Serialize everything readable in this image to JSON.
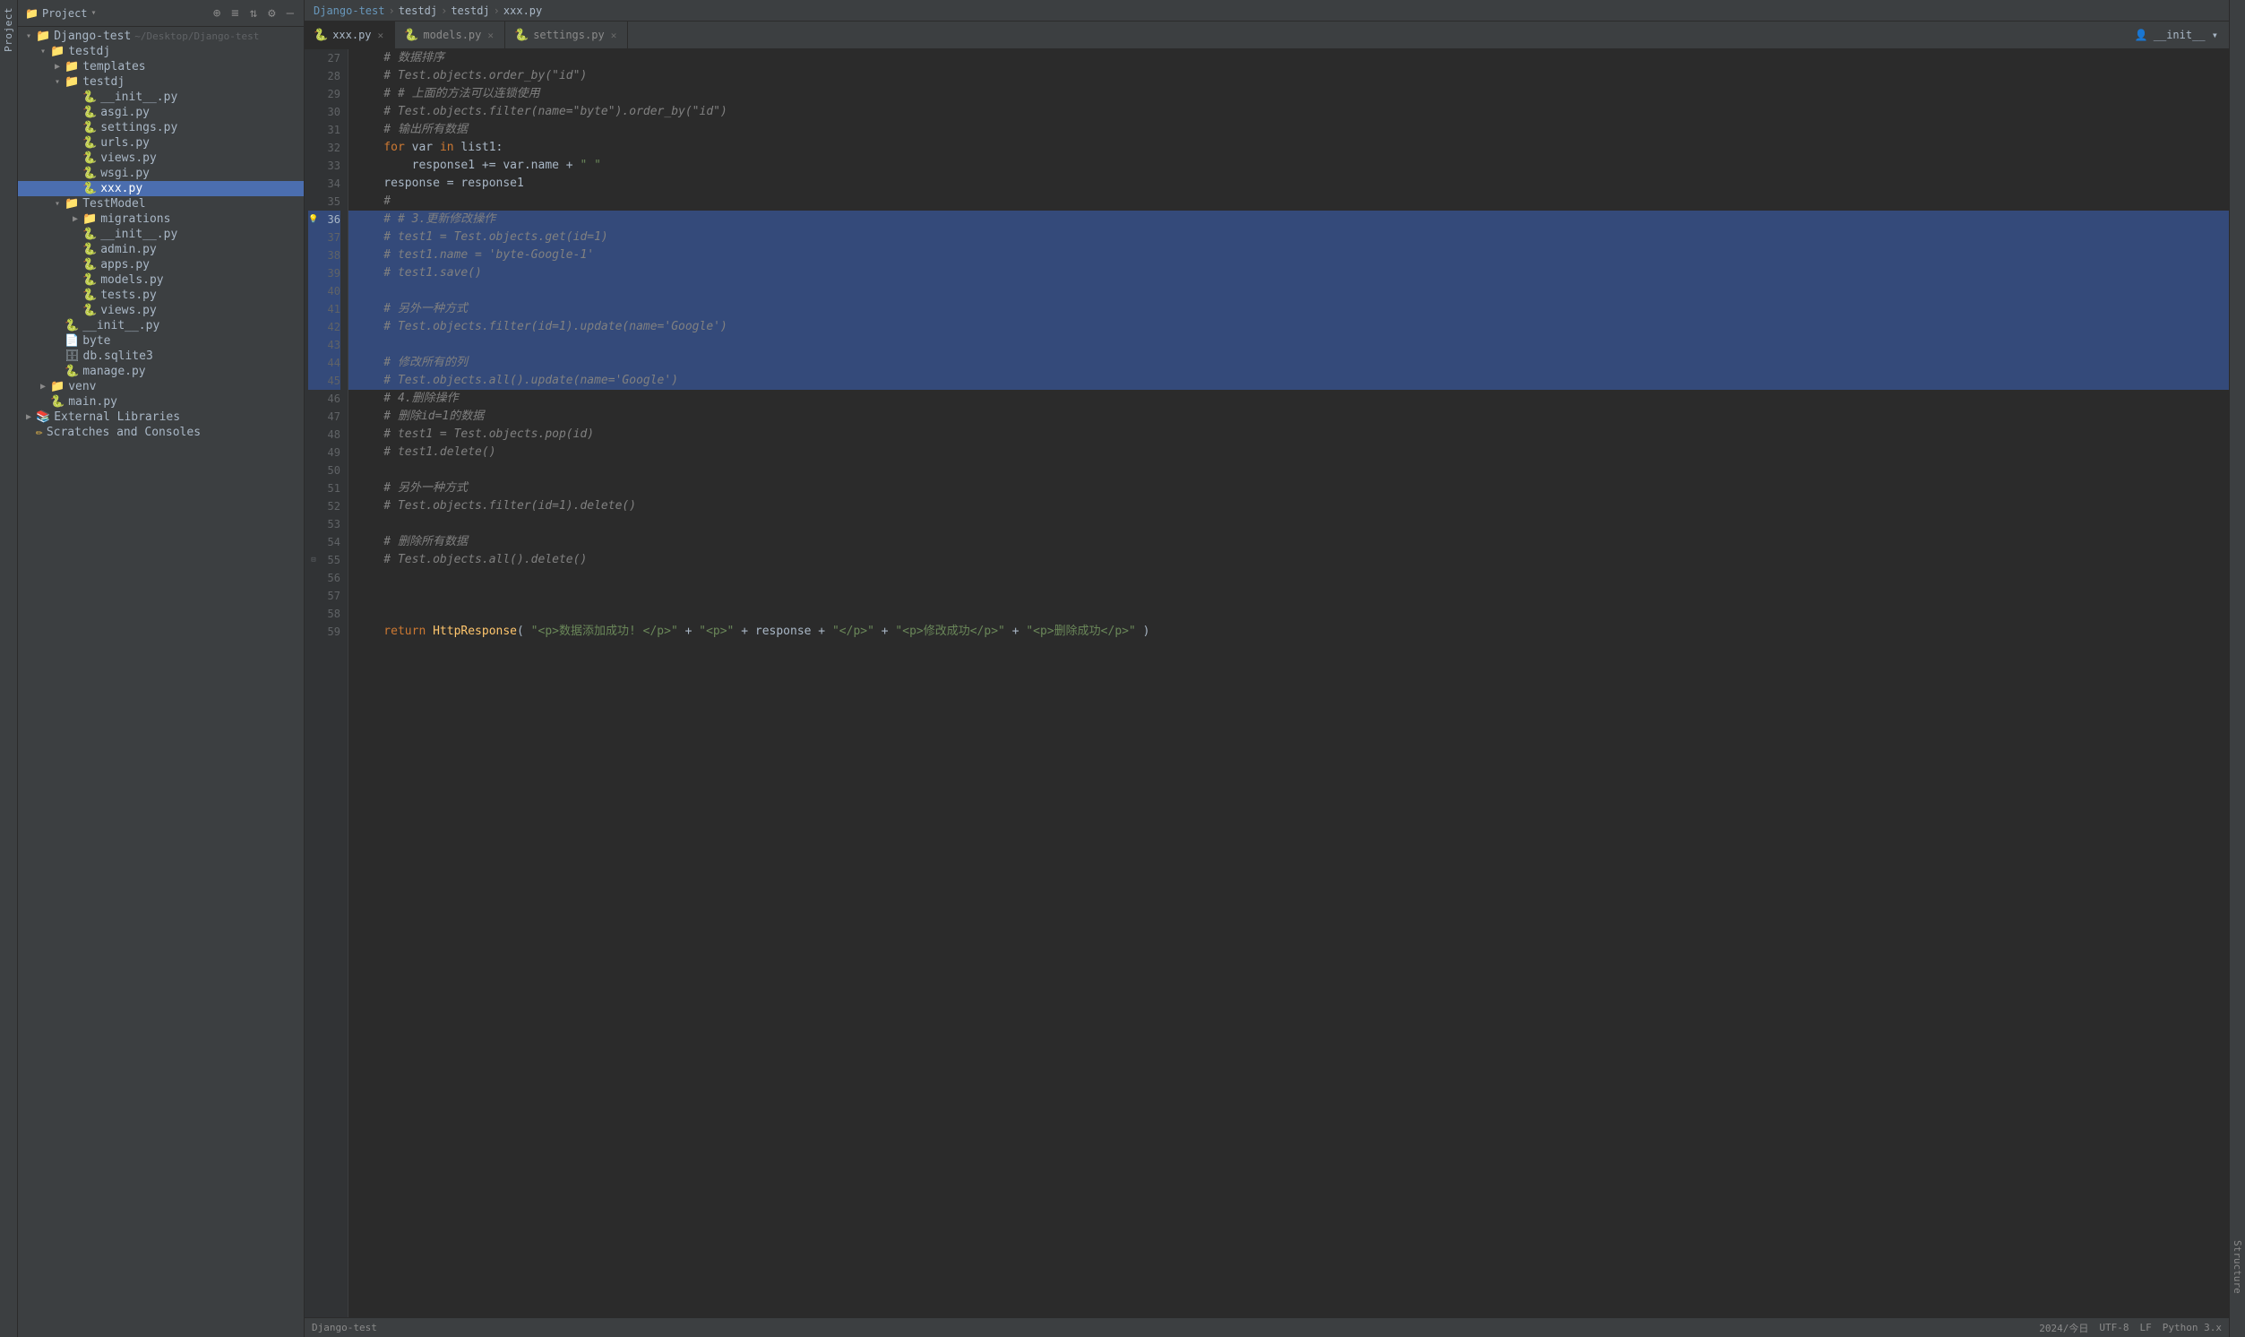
{
  "window": {
    "title": "Django-test"
  },
  "breadcrumb": {
    "items": [
      "Django-test",
      "testdj",
      "testdj",
      "xxx.py"
    ]
  },
  "tabs": [
    {
      "label": "xxx.py",
      "active": true,
      "icon": "py"
    },
    {
      "label": "models.py",
      "active": false,
      "icon": "py"
    },
    {
      "label": "settings.py",
      "active": false,
      "icon": "py"
    }
  ],
  "project_panel": {
    "title": "Project",
    "root": {
      "name": "Django-test",
      "path": "~/Desktop/Django-test",
      "children": [
        {
          "name": "testdj",
          "type": "folder",
          "expanded": true,
          "children": [
            {
              "name": "templates",
              "type": "folder",
              "expanded": false
            },
            {
              "name": "testdj",
              "type": "folder",
              "expanded": true,
              "children": [
                {
                  "name": "__init__.py",
                  "type": "py"
                },
                {
                  "name": "asgi.py",
                  "type": "py"
                },
                {
                  "name": "settings.py",
                  "type": "py"
                },
                {
                  "name": "urls.py",
                  "type": "py"
                },
                {
                  "name": "views.py",
                  "type": "py"
                },
                {
                  "name": "wsgi.py",
                  "type": "py"
                },
                {
                  "name": "xxx.py",
                  "type": "py",
                  "selected": true
                }
              ]
            },
            {
              "name": "TestModel",
              "type": "folder",
              "expanded": true,
              "children": [
                {
                  "name": "migrations",
                  "type": "folder",
                  "expanded": false
                },
                {
                  "name": "__init__.py",
                  "type": "py"
                },
                {
                  "name": "admin.py",
                  "type": "py"
                },
                {
                  "name": "apps.py",
                  "type": "py"
                },
                {
                  "name": "models.py",
                  "type": "py"
                },
                {
                  "name": "tests.py",
                  "type": "py"
                },
                {
                  "name": "views.py",
                  "type": "py"
                }
              ]
            },
            {
              "name": "__init__.py",
              "type": "py"
            },
            {
              "name": "byte",
              "type": "file"
            },
            {
              "name": "db.sqlite3",
              "type": "db"
            },
            {
              "name": "manage.py",
              "type": "py"
            }
          ]
        },
        {
          "name": "venv",
          "type": "folder",
          "expanded": false
        },
        {
          "name": "main.py",
          "type": "py"
        }
      ]
    },
    "extra_items": [
      {
        "name": "External Libraries",
        "type": "ext"
      },
      {
        "name": "Scratches and Consoles",
        "type": "scratches"
      }
    ]
  },
  "editor": {
    "lines": [
      {
        "num": 27,
        "code": "    # 数据排序",
        "type": "comment",
        "highlighted": false
      },
      {
        "num": 28,
        "code": "    # Test.objects.order_by(\"id\")",
        "type": "comment",
        "highlighted": false
      },
      {
        "num": 29,
        "code": "    # # 上面的方法可以连锁使用",
        "type": "comment",
        "highlighted": false
      },
      {
        "num": 30,
        "code": "    # Test.objects.filter(name=\"byte\").order_by(\"id\")",
        "type": "comment",
        "highlighted": false
      },
      {
        "num": 31,
        "code": "    # 输出所有数据",
        "type": "comment",
        "highlighted": false
      },
      {
        "num": 32,
        "code": "    for var in list1:",
        "type": "code",
        "highlighted": false
      },
      {
        "num": 33,
        "code": "        response1 += var.name + \" \"",
        "type": "code",
        "highlighted": false
      },
      {
        "num": 34,
        "code": "    response = response1",
        "type": "code",
        "highlighted": false
      },
      {
        "num": 35,
        "code": "    #",
        "type": "comment",
        "highlighted": false
      },
      {
        "num": 36,
        "code": "    # # 3.更新修改操作",
        "type": "comment",
        "highlighted": true,
        "bulb": true,
        "current": true
      },
      {
        "num": 37,
        "code": "    # test1 = Test.objects.get(id=1)",
        "type": "comment",
        "highlighted": true
      },
      {
        "num": 38,
        "code": "    # test1.name = 'byte-Google-1'",
        "type": "comment",
        "highlighted": true
      },
      {
        "num": 39,
        "code": "    # test1.save()",
        "type": "comment",
        "highlighted": true
      },
      {
        "num": 40,
        "code": "",
        "type": "empty",
        "highlighted": true
      },
      {
        "num": 41,
        "code": "    # 另外一种方式",
        "type": "comment",
        "highlighted": true
      },
      {
        "num": 42,
        "code": "    # Test.objects.filter(id=1).update(name='Google')",
        "type": "comment",
        "highlighted": true
      },
      {
        "num": 43,
        "code": "",
        "type": "empty",
        "highlighted": true
      },
      {
        "num": 44,
        "code": "    # 修改所有的列",
        "type": "comment",
        "highlighted": true
      },
      {
        "num": 45,
        "code": "    # Test.objects.all().update(name='Google')",
        "type": "comment",
        "highlighted": true
      },
      {
        "num": 46,
        "code": "    # 4.删除操作",
        "type": "comment",
        "highlighted": false
      },
      {
        "num": 47,
        "code": "    # 删除id=1的数据",
        "type": "comment",
        "highlighted": false
      },
      {
        "num": 48,
        "code": "    # test1 = Test.objects.pop(id)",
        "type": "comment",
        "highlighted": false
      },
      {
        "num": 49,
        "code": "    # test1.delete()",
        "type": "comment",
        "highlighted": false
      },
      {
        "num": 50,
        "code": "",
        "type": "empty",
        "highlighted": false
      },
      {
        "num": 51,
        "code": "    # 另外一种方式",
        "type": "comment",
        "highlighted": false
      },
      {
        "num": 52,
        "code": "    # Test.objects.filter(id=1).delete()",
        "type": "comment",
        "highlighted": false
      },
      {
        "num": 53,
        "code": "",
        "type": "empty",
        "highlighted": false
      },
      {
        "num": 54,
        "code": "    # 删除所有数据",
        "type": "comment",
        "highlighted": false
      },
      {
        "num": 55,
        "code": "    # Test.objects.all().delete()",
        "type": "comment",
        "highlighted": false,
        "fold": true
      },
      {
        "num": 56,
        "code": "",
        "type": "empty",
        "highlighted": false
      },
      {
        "num": 57,
        "code": "",
        "type": "empty",
        "highlighted": false
      },
      {
        "num": 58,
        "code": "",
        "type": "empty",
        "highlighted": false
      },
      {
        "num": 59,
        "code": "    return HttpResponse( \"<p>数据添加成功! </p>\" + \"<p>\" + response + \"</p>\" + \"<p>修改成功</p>\" + \"<p>删除成功</p>\" )",
        "type": "code",
        "highlighted": false
      }
    ]
  },
  "status_bar": {
    "left": [
      "Django-test"
    ],
    "right": [
      "2024/今日",
      "UTF-8",
      "LF",
      "Python 3.x"
    ]
  },
  "top_right": {
    "user": "__init__",
    "dropdown_label": "__init__ ▾"
  }
}
